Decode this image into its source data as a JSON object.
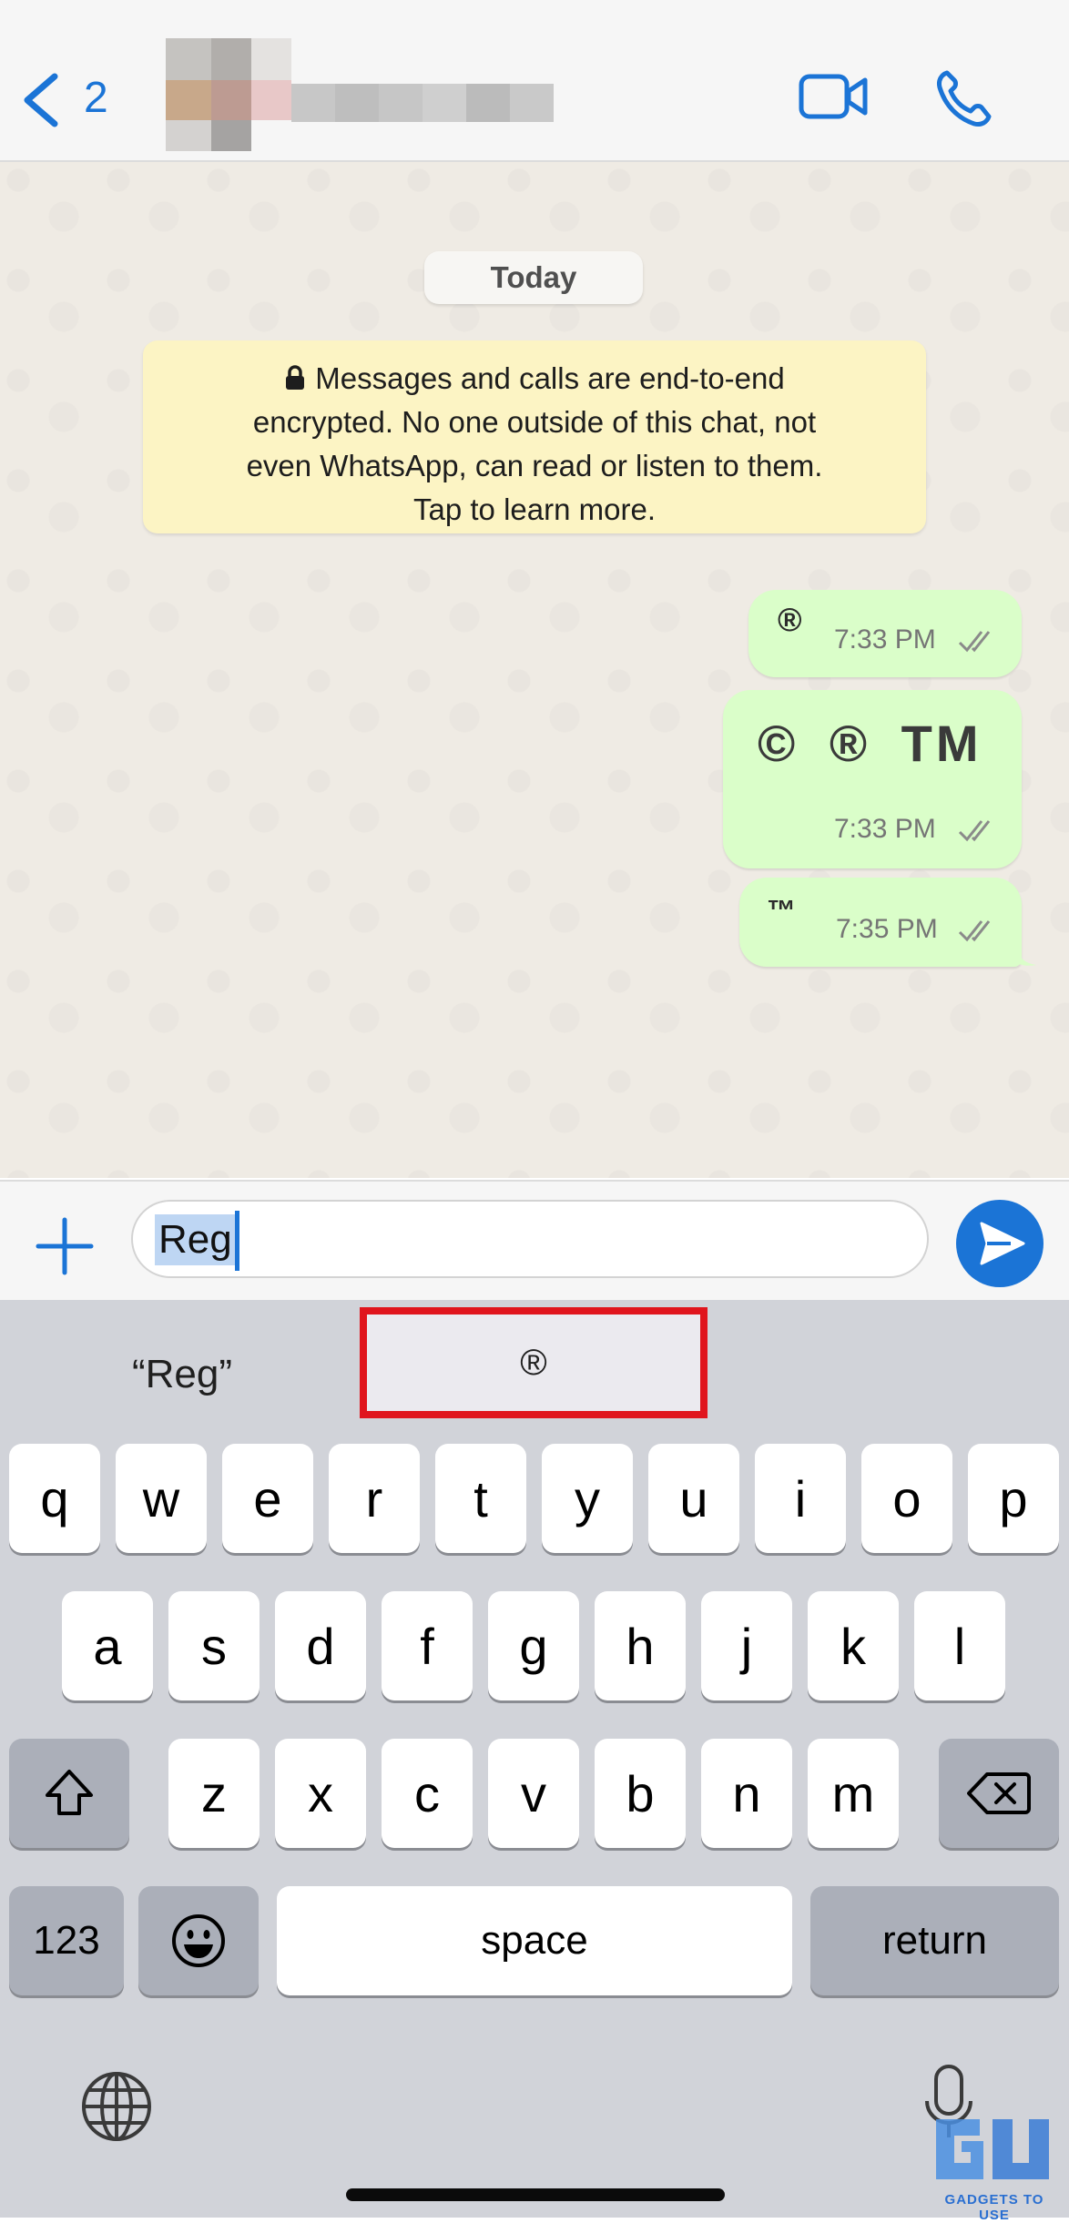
{
  "header": {
    "back_count": "2",
    "video_call_icon": "video-camera-icon",
    "voice_call_icon": "phone-icon"
  },
  "chat": {
    "date_label": "Today",
    "encryption_notice": {
      "lines": [
        "Messages and calls are end-to-end",
        "encrypted. No one outside of this chat, not",
        "even WhatsApp, can read or listen to them.",
        "Tap to learn more."
      ],
      "icon": "lock-icon"
    },
    "messages": [
      {
        "text": "®",
        "time": "7:33 PM",
        "status": "read"
      },
      {
        "text": "© ® TM",
        "time": "7:33 PM",
        "status": "read"
      },
      {
        "text": "™",
        "time": "7:35 PM",
        "status": "read"
      }
    ]
  },
  "composer": {
    "input_value": "Reg",
    "plus_icon": "plus-icon",
    "sticker_icon": "sticker-icon",
    "send_icon": "send-icon"
  },
  "keyboard": {
    "suggestions": [
      "“Reg”",
      "®"
    ],
    "rows": [
      [
        "q",
        "w",
        "e",
        "r",
        "t",
        "y",
        "u",
        "i",
        "o",
        "p"
      ],
      [
        "a",
        "s",
        "d",
        "f",
        "g",
        "h",
        "j",
        "k",
        "l"
      ],
      [
        "z",
        "x",
        "c",
        "v",
        "b",
        "n",
        "m"
      ]
    ],
    "numbers_key": "123",
    "space_key": "space",
    "return_key": "return"
  },
  "accent_color": "#1b74d6",
  "highlight_color": "#e0151d"
}
